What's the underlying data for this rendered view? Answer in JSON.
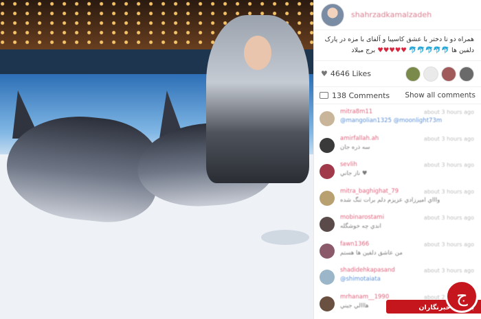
{
  "post": {
    "username": "shahrzadkamalzadeh",
    "caption": {
      "text": "همراه دو تا دختر با عشق کاسپیا و آلفای با مزه در پارک دلفین ها",
      "suffix": "برج میلاد",
      "dolphin_emojis": "🐬🐬🐬🐬🐬",
      "hearts": "♥♥♥♥♥"
    },
    "likes": "4646 Likes",
    "comments_count": "138 Comments",
    "show_all": "Show all comments"
  },
  "comments": [
    {
      "user": "mitra8m11",
      "time": "about 3 hours ago",
      "text": "@mangolian1325 @moonlight73m",
      "link": true,
      "avatar_color": "#c9b59a"
    },
    {
      "user": "amirfallah.ah",
      "time": "about 3 hours ago",
      "text": "سه ذره جان",
      "link": false,
      "avatar_color": "#3a3a3a"
    },
    {
      "user": "sevlih",
      "time": "about 3 hours ago",
      "text": "ناز جاني ♥",
      "link": false,
      "avatar_color": "#a03a4a"
    },
    {
      "user": "mitra_baghighat_79",
      "time": "about 3 hours ago",
      "text": "واااي اميرزادي عزيزم دلم برات تنگ شده",
      "link": false,
      "avatar_color": "#b8a070"
    },
    {
      "user": "mobinarostami",
      "time": "about 3 hours ago",
      "text": "اندي چه خوشگله",
      "link": false,
      "avatar_color": "#5a4a4a"
    },
    {
      "user": "fawn1366",
      "time": "about 3 hours ago",
      "text": "من عاشق دلفين ها هستم",
      "link": false,
      "avatar_color": "#8a5a6a"
    },
    {
      "user": "shadidehkapasand",
      "time": "about 3 hours ago",
      "text": "@shimotaiata",
      "link": true,
      "avatar_color": "#9ab6c8"
    },
    {
      "user": "mrhanam__1990",
      "time": "about 2 hours ago",
      "text": "هااالي جيني",
      "link": false,
      "avatar_color": "#6a5040"
    }
  ],
  "watermark": {
    "text": "باشگاه خبرنگاران",
    "logo_glyph": "ج"
  },
  "colors": {
    "username": "#d87f91",
    "comment_user": "#e0627c",
    "link": "#5b8fd4",
    "brand_red": "#c4161c"
  }
}
